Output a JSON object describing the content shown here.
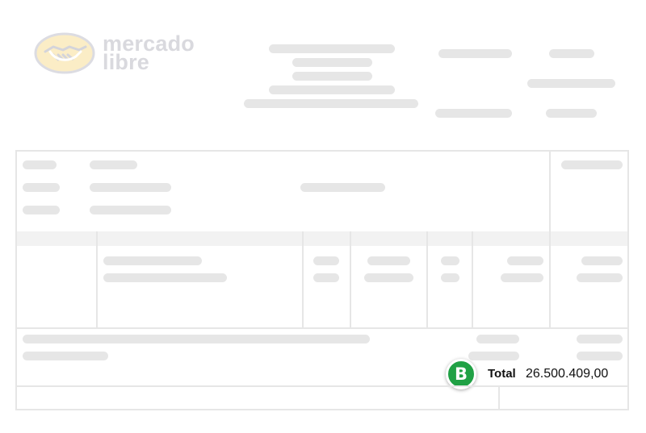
{
  "logo": {
    "line1": "mercado",
    "line2": "libre",
    "icon": "handshake-icon",
    "color": "#d9d9de",
    "icon_fill": "#fbedc6"
  },
  "placeholder_color": "#e6e6e6",
  "badge": {
    "letter": "B",
    "color": "#20a145"
  },
  "total": {
    "label": "Total",
    "value": "26.500.409,00"
  }
}
